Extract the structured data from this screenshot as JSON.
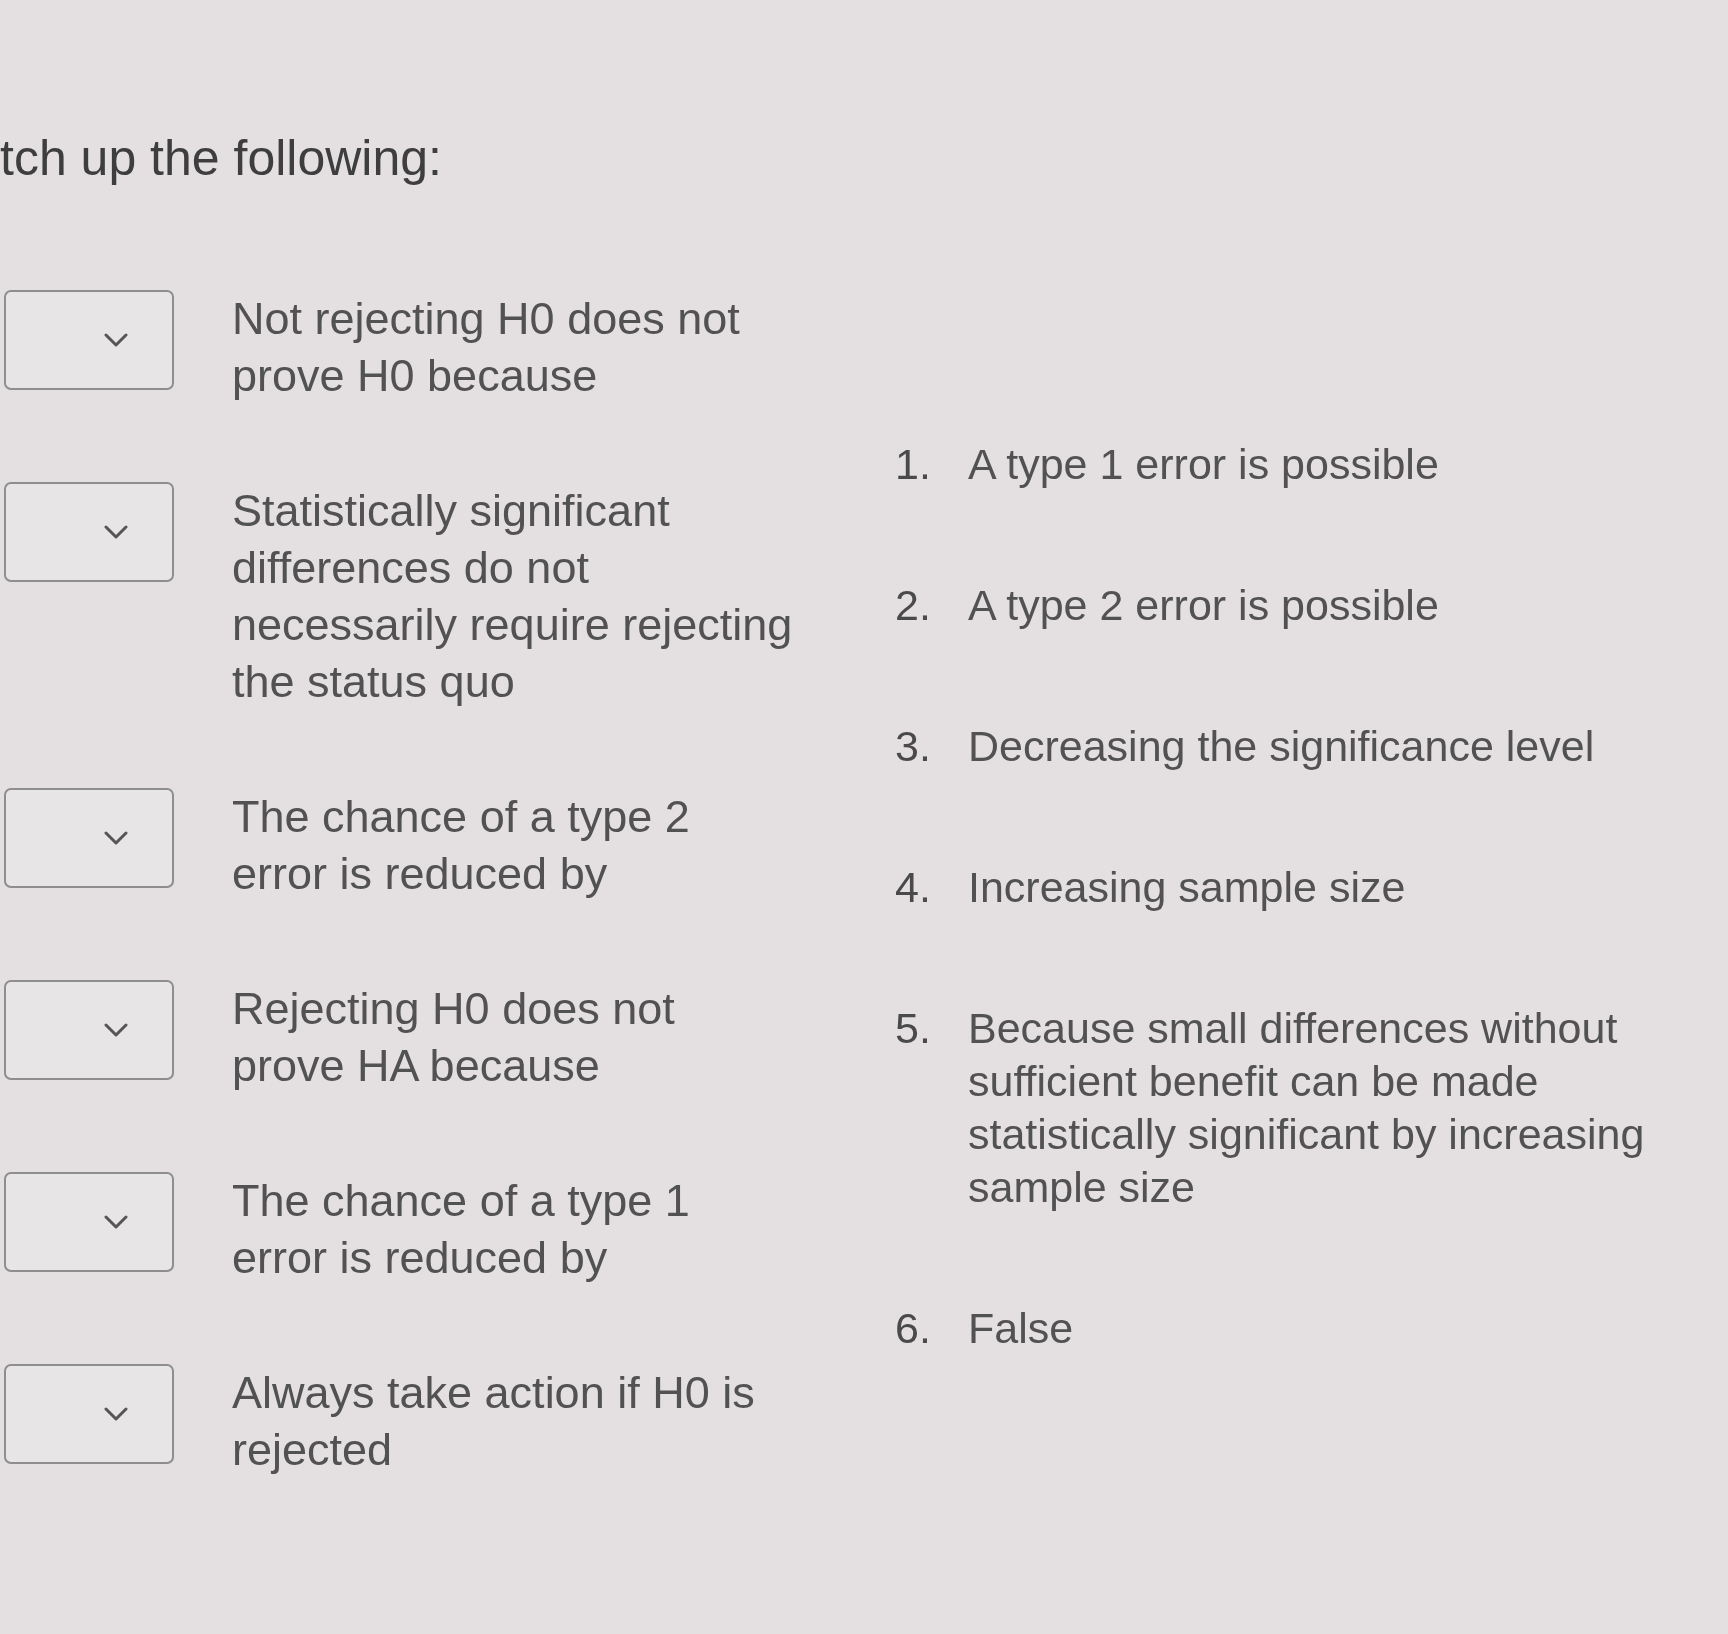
{
  "instruction": "tch up the following:",
  "prompts": [
    {
      "text": "Not rejecting H0 does not prove H0 because"
    },
    {
      "text": "Statistically significant differences do not necessarily require rejecting the status quo"
    },
    {
      "text": "The chance of a type 2 error is reduced by"
    },
    {
      "text": "Rejecting H0 does not prove HA because"
    },
    {
      "text": "The chance of a type 1 error is reduced by"
    },
    {
      "text": "Always take action if H0 is rejected"
    }
  ],
  "options": [
    {
      "number": "1.",
      "text": "A type 1 error is possible"
    },
    {
      "number": "2.",
      "text": "A type 2 error is possible"
    },
    {
      "number": "3.",
      "text": "Decreasing the significance level"
    },
    {
      "number": "4.",
      "text": "Increasing sample size"
    },
    {
      "number": "5.",
      "text": "Because small differences without sufficient benefit can be made statistically significant by increasing sample size"
    },
    {
      "number": "6.",
      "text": "False"
    }
  ]
}
